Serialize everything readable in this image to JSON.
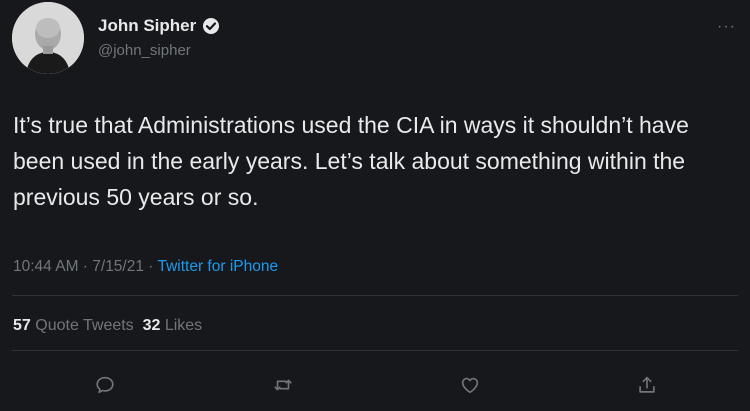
{
  "author": {
    "name": "John Sipher",
    "handle": "@john_sipher",
    "verified": true
  },
  "tweet": {
    "text": "It’s true that Administrations used the CIA in ways it shouldn’t have been used in the early years. Let’s talk about something within the previous 50 years or so.",
    "time": "10:44 AM · 7/15/21 · ",
    "source": "Twitter for iPhone"
  },
  "stats": {
    "quote_count": "57",
    "quote_label": "Quote Tweets",
    "like_count": "32",
    "like_label": "Likes"
  },
  "menu": {
    "more_label": "···"
  },
  "actions": [
    {
      "icon": "reply-icon"
    },
    {
      "icon": "retweet-icon"
    },
    {
      "icon": "like-icon"
    },
    {
      "icon": "share-icon"
    }
  ],
  "colors": {
    "background": "#16181c",
    "text": "#e7e9ea",
    "muted": "#71767b",
    "accent": "#1d9bf0"
  }
}
